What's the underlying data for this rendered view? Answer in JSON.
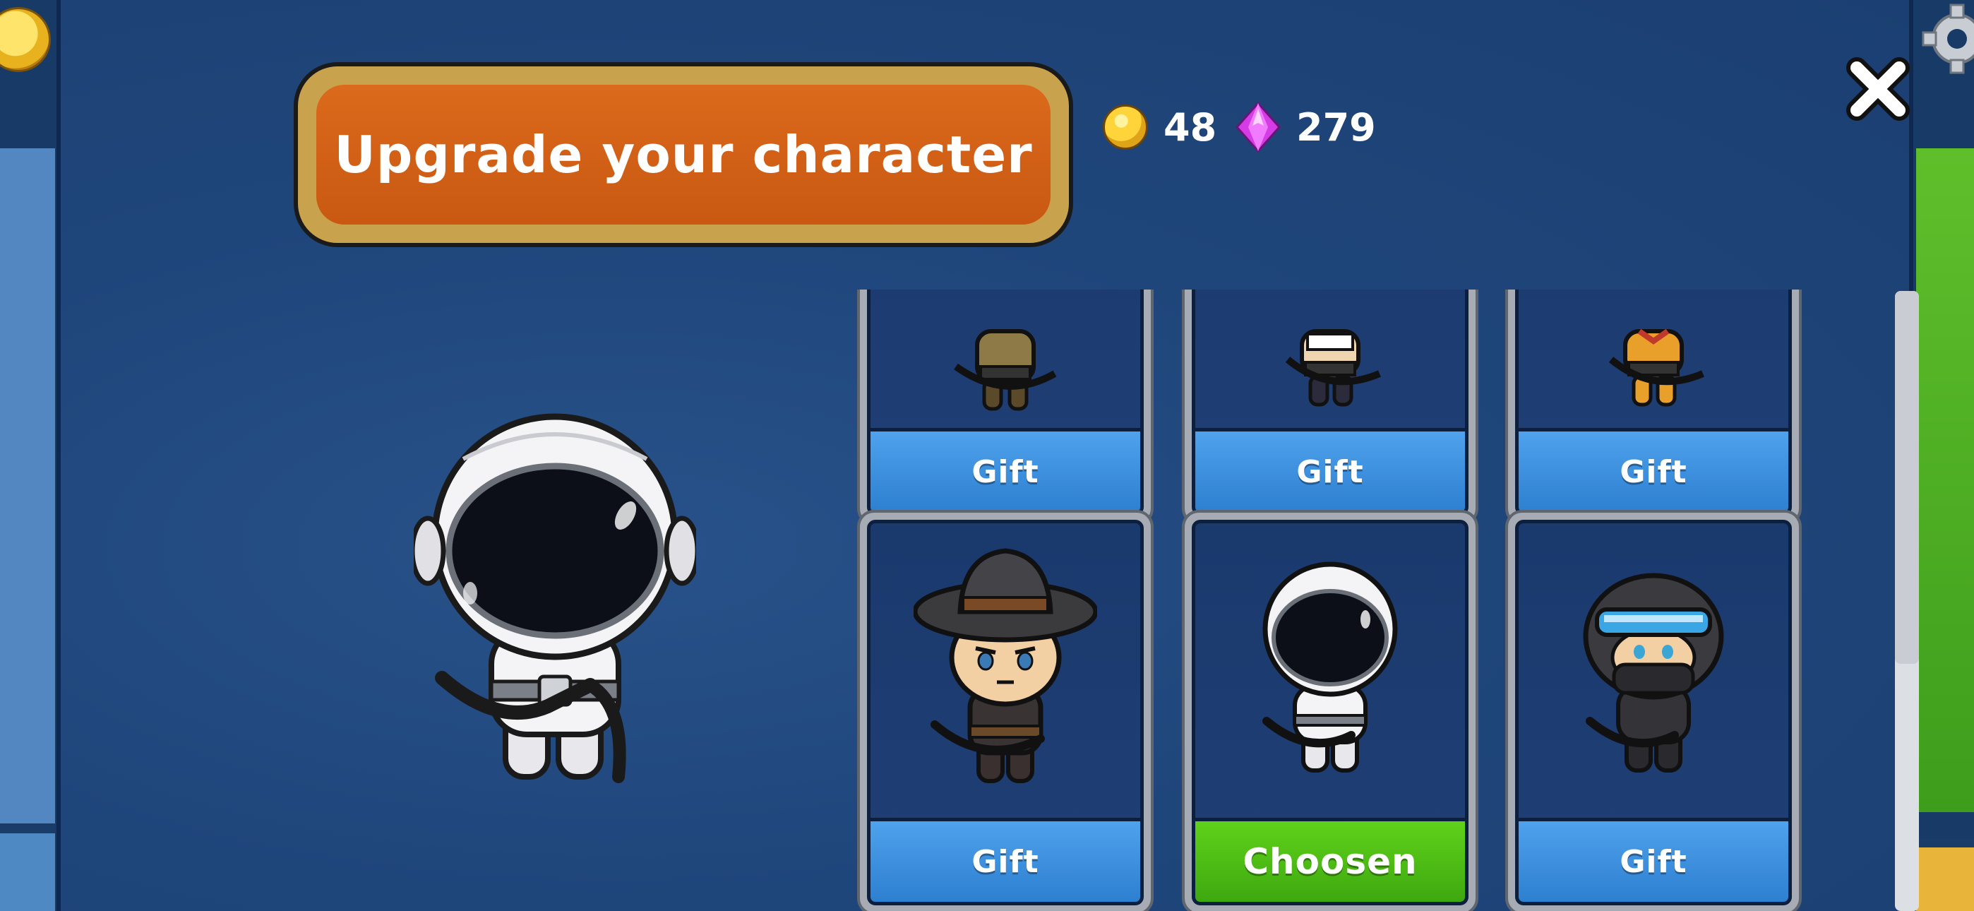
{
  "title": "Upgrade your character",
  "currency": {
    "coins": "48",
    "gems": "279"
  },
  "selected_character": "astronaut",
  "cards": [
    {
      "character": "explorer",
      "button": "Gift",
      "chosen": false
    },
    {
      "character": "maid",
      "button": "Gift",
      "chosen": false
    },
    {
      "character": "bandit",
      "button": "Gift",
      "chosen": false
    },
    {
      "character": "cowboy",
      "button": "Gift",
      "chosen": false
    },
    {
      "character": "astronaut",
      "button": "Choosen",
      "chosen": true
    },
    {
      "character": "ninja-goggles",
      "button": "Gift",
      "chosen": false
    }
  ],
  "icons": {
    "close": "close-icon",
    "coin": "coin-icon",
    "gem": "gem-icon",
    "settings": "gear-icon"
  },
  "colors": {
    "panel": "#1f467b",
    "title_bg": "#d5621a",
    "title_border": "#c9a24e",
    "gift_button": "#3d8fdf",
    "chosen_button": "#4fc015"
  }
}
